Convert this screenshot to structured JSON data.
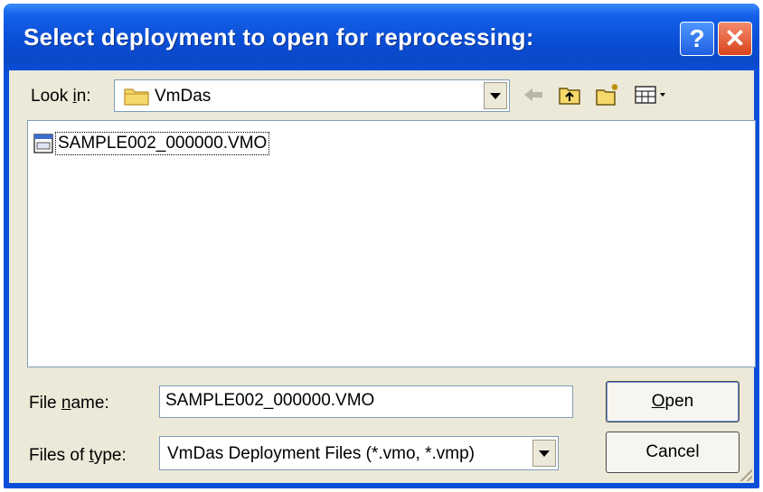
{
  "window": {
    "title": "Select deployment to open for reprocessing:",
    "help_glyph": "?",
    "close_glyph": "✕"
  },
  "look_in": {
    "label_prefix": "Look ",
    "label_accel": "i",
    "label_suffix": "n:",
    "value": "VmDas",
    "icon": "folder-icon"
  },
  "toolbar": {
    "back_icon": "back-arrow-icon",
    "up_icon": "up-folder-icon",
    "new_folder_icon": "new-folder-icon",
    "view_menu_icon": "view-menu-icon"
  },
  "files": [
    {
      "name": "SAMPLE002_000000.VMO",
      "icon": "vmo-file-icon"
    }
  ],
  "file_name": {
    "label_prefix": "File ",
    "label_accel": "n",
    "label_suffix": "ame:",
    "value": "SAMPLE002_000000.VMO"
  },
  "files_of_type": {
    "label_prefix": "Files of ",
    "label_accel": "t",
    "label_suffix": "ype:",
    "value": "VmDas Deployment Files (*.vmo, *.vmp)"
  },
  "buttons": {
    "open_accel": "O",
    "open_rest": "pen",
    "cancel": "Cancel"
  },
  "colors": {
    "title_bar": "#0b4fd8",
    "dialog_face": "#ece9d8",
    "close_button": "#d9441c"
  }
}
